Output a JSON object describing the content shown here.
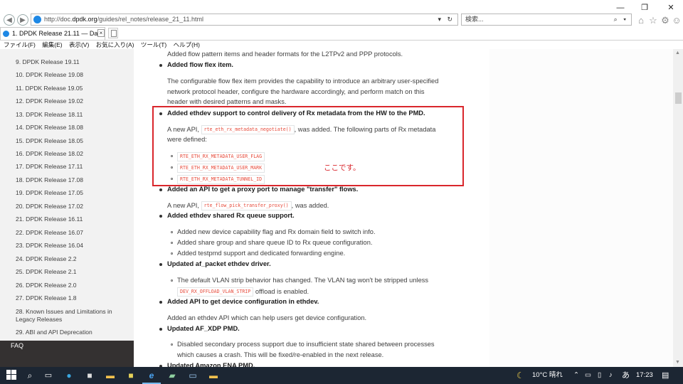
{
  "browser": {
    "url_prefix": "http://doc.",
    "url_host": "dpdk.org",
    "url_path": "/guides/rel_notes/release_21_11.html",
    "search_placeholder": "検索...",
    "tab_title": "1. DPDK Release 21.11 — Da...",
    "tab_close": "×",
    "menu": [
      "ファイル(F)",
      "編集(E)",
      "表示(V)",
      "お気に入り(A)",
      "ツール(T)",
      "ヘルプ(H)"
    ]
  },
  "sidebar": {
    "items": [
      "9. DPDK Release 19.11",
      "10. DPDK Release 19.08",
      "11. DPDK Release 19.05",
      "12. DPDK Release 19.02",
      "13. DPDK Release 18.11",
      "14. DPDK Release 18.08",
      "15. DPDK Release 18.05",
      "16. DPDK Release 18.02",
      "17. DPDK Release 17.11",
      "18. DPDK Release 17.08",
      "19. DPDK Release 17.05",
      "20. DPDK Release 17.02",
      "21. DPDK Release 16.11",
      "22. DPDK Release 16.07",
      "23. DPDK Release 16.04",
      "24. DPDK Release 2.2",
      "25. DPDK Release 2.1",
      "26. DPDK Release 2.0",
      "27. DPDK Release 1.8",
      "28. Known Issues and Limitations in",
      "Legacy Releases",
      "29. ABI and API Deprecation"
    ],
    "faq": "FAQ"
  },
  "content": {
    "l2tp_text": "Added flow pattern items and header formats for the L2TPv2 and PPP protocols.",
    "flex_heading": "Added flow flex item.",
    "flex_p1": "The configurable flow flex item provides the capability to introduce an arbitrary user-specified",
    "flex_p2": "network protocol header, configure the hardware accordingly, and perform match on this",
    "flex_p3": "header with desired patterns and masks.",
    "rxmeta_heading": "Added ethdev support to control delivery of Rx metadata from the HW to the PMD.",
    "rxmeta_pre": "A new API,",
    "rxmeta_api": "rte_eth_rx_metadata_negotiate()",
    "rxmeta_post": ", was added. The following parts of Rx metadata",
    "rxmeta_p2": "were defined:",
    "rxmeta_flags": [
      "RTE_ETH_RX_METADATA_USER_FLAG",
      "RTE_ETH_RX_METADATA_USER_MARK",
      "RTE_ETH_RX_METADATA_TUNNEL_ID"
    ],
    "annotation": "ここです。",
    "proxy_heading": "Added an API to get a proxy port to manage \"transfer\" flows.",
    "proxy_pre": "A new API,",
    "proxy_api": "rte_flow_pick_transfer_proxy()",
    "proxy_post": ", was added.",
    "sharedrx_heading": "Added ethdev shared Rx queue support.",
    "sharedrx_items": [
      "Added new device capability flag and Rx domain field to switch info.",
      "Added share group and share queue ID to Rx queue configuration.",
      "Added testpmd support and dedicated forwarding engine."
    ],
    "afpacket_heading": "Updated af_packet ethdev driver.",
    "afpacket_item": "The default VLAN strip behavior has changed. The VLAN tag won't be stripped unless",
    "afpacket_code": "DEV_RX_OFFLOAD_VLAN_STRIP",
    "afpacket_post": "offload is enabled.",
    "devconf_heading": "Added API to get device configuration in ethdev.",
    "devconf_text": "Added an ethdev API which can help users get device configuration.",
    "afxdp_heading": "Updated AF_XDP PMD.",
    "afxdp_item1": "Disabled secondary process support due to insufficient state shared between processes",
    "afxdp_item2": "which causes a crash. This will be fixed/re-enabled in the next release.",
    "ena_heading": "Updated Amazon ENA PMD."
  },
  "taskbar": {
    "weather": "10°C 晴れ",
    "ime": "あ",
    "time": "17:23"
  },
  "colors": {
    "annotation": "#d9262c",
    "sidebar_dark": "#343131",
    "code": "#e74c3c"
  }
}
